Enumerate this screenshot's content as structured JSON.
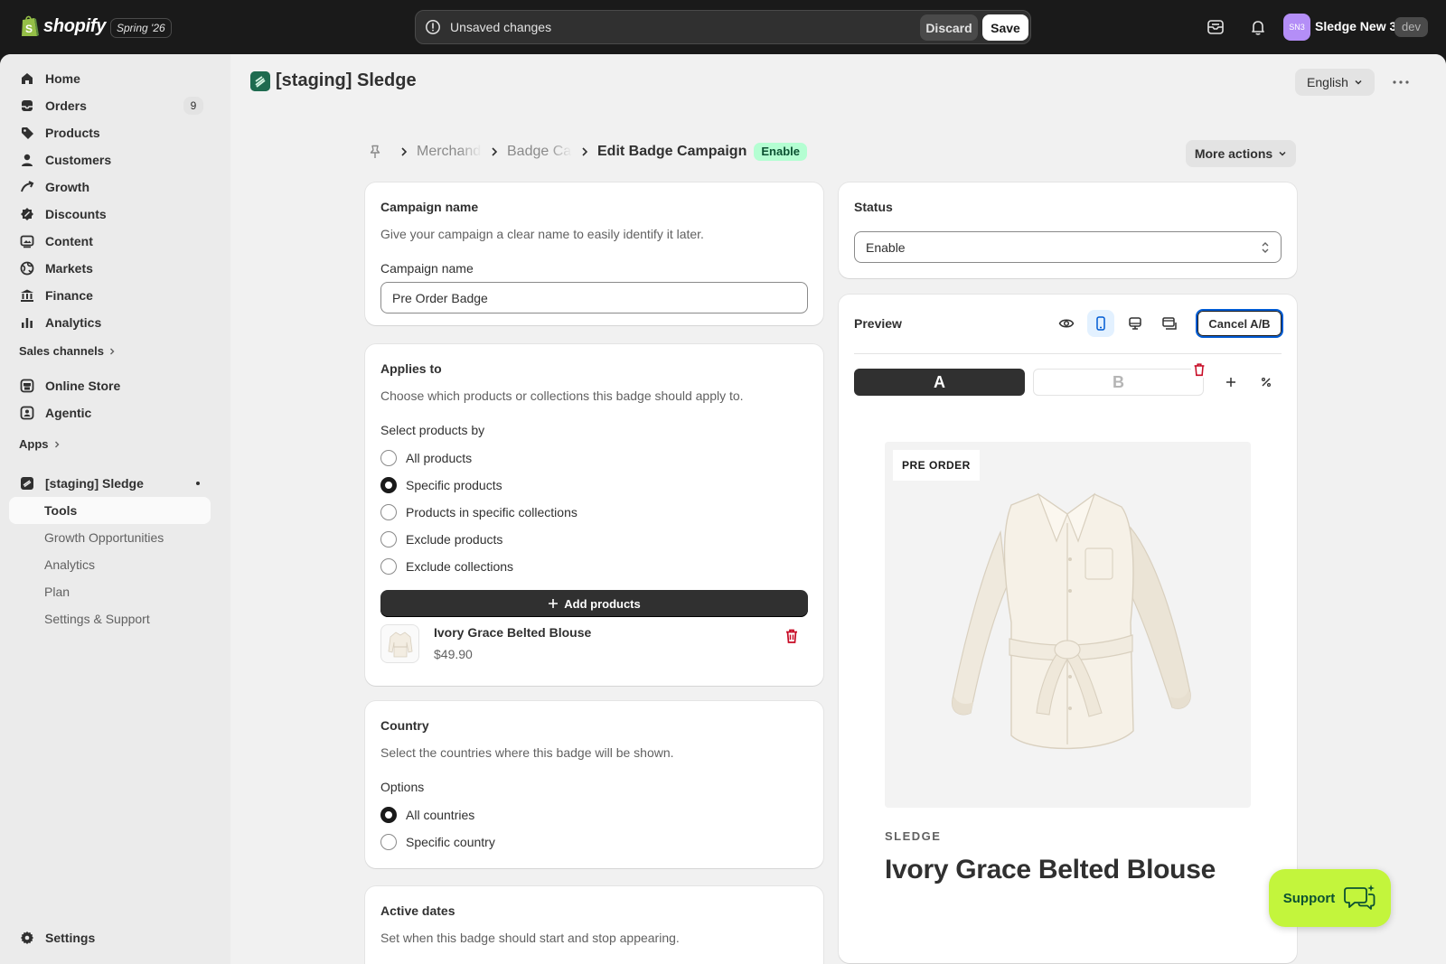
{
  "topbar": {
    "brand": "shopify",
    "release_badge": "Spring '26",
    "unsaved_message": "Unsaved changes",
    "discard_label": "Discard",
    "save_label": "Save",
    "avatar_initials": "SN3",
    "store_name": "Sledge New 3",
    "env_badge": "dev"
  },
  "sidebar": {
    "items": [
      {
        "label": "Home",
        "icon": "home-icon"
      },
      {
        "label": "Orders",
        "icon": "orders-icon",
        "count": "9"
      },
      {
        "label": "Products",
        "icon": "tag-icon"
      },
      {
        "label": "Customers",
        "icon": "person-icon"
      },
      {
        "label": "Growth",
        "icon": "growth-icon"
      },
      {
        "label": "Discounts",
        "icon": "discount-icon"
      },
      {
        "label": "Content",
        "icon": "content-icon"
      },
      {
        "label": "Markets",
        "icon": "globe-icon"
      },
      {
        "label": "Finance",
        "icon": "bank-icon"
      },
      {
        "label": "Analytics",
        "icon": "bar-chart-icon"
      }
    ],
    "sales_channels_label": "Sales channels",
    "channels": [
      {
        "label": "Online Store",
        "icon": "store-icon"
      },
      {
        "label": "Agentic",
        "icon": "agentic-icon"
      }
    ],
    "apps_label": "Apps",
    "app": {
      "label": "[staging] Sledge",
      "subitems": [
        "Tools",
        "Growth Opportunities",
        "Analytics",
        "Plan",
        "Settings & Support"
      ],
      "active_subitem": "Tools"
    },
    "settings_label": "Settings"
  },
  "header": {
    "app_title": "[staging] Sledge",
    "language": "English"
  },
  "breadcrumb": {
    "items": [
      "Merchandising",
      "Badge Campaigns"
    ],
    "current": "Edit Badge Campaign",
    "status_badge": "Enable",
    "more_actions": "More actions"
  },
  "campaign_card": {
    "title": "Campaign name",
    "description": "Give your campaign a clear name to easily identify it later.",
    "field_label": "Campaign name",
    "value": "Pre Order Badge"
  },
  "applies_card": {
    "title": "Applies to",
    "description": "Choose which products or collections this badge should apply to.",
    "group_label": "Select products by",
    "options": [
      "All products",
      "Specific products",
      "Products in specific collections",
      "Exclude products",
      "Exclude collections"
    ],
    "selected": "Specific products",
    "add_button": "Add products",
    "product": {
      "name": "Ivory Grace Belted Blouse",
      "price": "$49.90"
    }
  },
  "country_card": {
    "title": "Country",
    "description": "Select the countries where this badge will be shown.",
    "group_label": "Options",
    "options": [
      "All countries",
      "Specific country"
    ],
    "selected": "All countries"
  },
  "dates_card": {
    "title": "Active dates",
    "description": "Set when this badge should start and stop appearing."
  },
  "status_card": {
    "title": "Status",
    "value": "Enable"
  },
  "preview_card": {
    "title": "Preview",
    "cancel_ab": "Cancel A/B",
    "variant_a": "A",
    "variant_b": "B",
    "badge_text": "PRE ORDER",
    "vendor": "SLEDGE",
    "product_title": "Ivory Grace Belted Blouse"
  },
  "support": {
    "label": "Support"
  },
  "colors": {
    "topbar_bg": "#1a1a1a",
    "surface": "#f1f1f1",
    "card": "#ffffff",
    "enable_badge_bg": "#b4fed2",
    "support_bg": "#c3f53c",
    "danger": "#c70a24",
    "focus": "#005bd3"
  }
}
